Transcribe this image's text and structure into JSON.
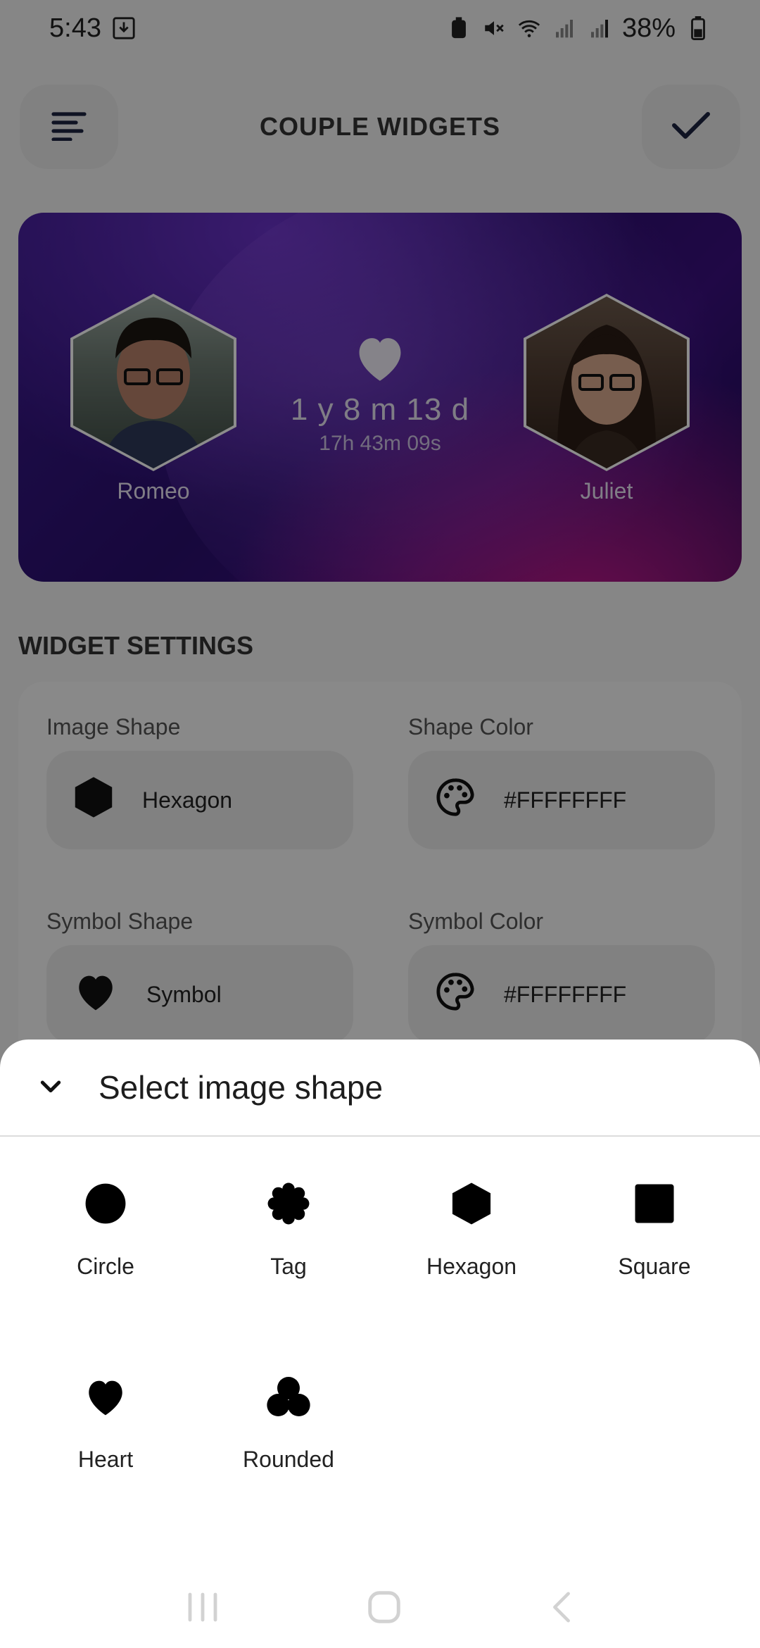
{
  "status_bar": {
    "time": "5:43",
    "battery": "38%",
    "icons": [
      "download-icon",
      "alarm-icon",
      "mute-icon",
      "wifi-icon",
      "signal-icon",
      "signal-icon",
      "battery-icon"
    ]
  },
  "app_bar": {
    "title": "COUPLE WIDGETS",
    "menu_icon": "menu-icon",
    "confirm_icon": "check-icon"
  },
  "preview": {
    "left_name": "Romeo",
    "right_name": "Juliet",
    "duration": "1 y 8 m 13 d",
    "time": "17h 43m 09s",
    "symbol_icon": "heart-icon"
  },
  "settings": {
    "section_title": "WIDGET SETTINGS",
    "image_shape_label": "Image Shape",
    "image_shape_value": "Hexagon",
    "shape_color_label": "Shape Color",
    "shape_color_value": "#FFFFFFFF",
    "symbol_shape_label": "Symbol Shape",
    "symbol_shape_value": "Symbol",
    "symbol_color_label": "Symbol Color",
    "symbol_color_value": "#FFFFFFFF"
  },
  "sheet": {
    "title": "Select image shape",
    "shapes": [
      {
        "label": "Circle",
        "icon": "circle-shape-icon"
      },
      {
        "label": "Tag",
        "icon": "tag-shape-icon"
      },
      {
        "label": "Hexagon",
        "icon": "hexagon-shape-icon"
      },
      {
        "label": "Square",
        "icon": "square-shape-icon"
      },
      {
        "label": "Heart",
        "icon": "heart-shape-icon"
      },
      {
        "label": "Rounded",
        "icon": "rounded-shape-icon"
      }
    ]
  },
  "colors": {
    "accent": "#3a1a8c",
    "sheet_bg": "#ffffff"
  }
}
